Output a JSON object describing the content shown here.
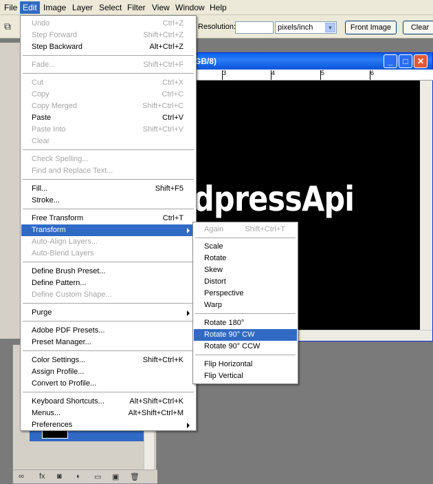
{
  "menubar": {
    "items": [
      "File",
      "Edit",
      "Image",
      "Layer",
      "Select",
      "Filter",
      "View",
      "Window",
      "Help"
    ],
    "active": "Edit"
  },
  "options_bar": {
    "resolution_label": "Resolution:",
    "resolution_value": "",
    "unit": "pixels/inch",
    "front_image_button": "Front Image",
    "clear_button": "Clear"
  },
  "document": {
    "title": "GB/8)",
    "canvas_text": "dpressApi",
    "ruler_numbers": [
      "3",
      "4",
      "5",
      "6"
    ]
  },
  "edit_menu": {
    "items": [
      {
        "label": "Undo",
        "shortcut": "Ctrl+Z",
        "disabled": true
      },
      {
        "label": "Step Forward",
        "shortcut": "Shift+Ctrl+Z",
        "disabled": true
      },
      {
        "label": "Step Backward",
        "shortcut": "Alt+Ctrl+Z",
        "disabled": false
      },
      {
        "label": "Fade...",
        "shortcut": "Shift+Ctrl+F",
        "disabled": true
      },
      {
        "label": "Cut",
        "shortcut": "Ctrl+X",
        "disabled": true
      },
      {
        "label": "Copy",
        "shortcut": "Ctrl+C",
        "disabled": true
      },
      {
        "label": "Copy Merged",
        "shortcut": "Shift+Ctrl+C",
        "disabled": true
      },
      {
        "label": "Paste",
        "shortcut": "Ctrl+V",
        "disabled": false
      },
      {
        "label": "Paste Into",
        "shortcut": "Shift+Ctrl+V",
        "disabled": true
      },
      {
        "label": "Clear",
        "shortcut": "",
        "disabled": true
      },
      {
        "label": "Check Spelling...",
        "shortcut": "",
        "disabled": true
      },
      {
        "label": "Find and Replace Text...",
        "shortcut": "",
        "disabled": true
      },
      {
        "label": "Fill...",
        "shortcut": "Shift+F5",
        "disabled": false
      },
      {
        "label": "Stroke...",
        "shortcut": "",
        "disabled": false
      },
      {
        "label": "Free Transform",
        "shortcut": "Ctrl+T",
        "disabled": false
      },
      {
        "label": "Transform",
        "shortcut": "",
        "disabled": false
      },
      {
        "label": "Auto-Align Layers...",
        "shortcut": "",
        "disabled": true
      },
      {
        "label": "Auto-Blend Layers",
        "shortcut": "",
        "disabled": true
      },
      {
        "label": "Define Brush Preset...",
        "shortcut": "",
        "disabled": false
      },
      {
        "label": "Define Pattern...",
        "shortcut": "",
        "disabled": false
      },
      {
        "label": "Define Custom Shape...",
        "shortcut": "",
        "disabled": true
      },
      {
        "label": "Purge",
        "shortcut": "",
        "disabled": false
      },
      {
        "label": "Adobe PDF Presets...",
        "shortcut": "",
        "disabled": false
      },
      {
        "label": "Preset Manager...",
        "shortcut": "",
        "disabled": false
      },
      {
        "label": "Color Settings...",
        "shortcut": "Shift+Ctrl+K",
        "disabled": false
      },
      {
        "label": "Assign Profile...",
        "shortcut": "",
        "disabled": false
      },
      {
        "label": "Convert to Profile...",
        "shortcut": "",
        "disabled": false
      },
      {
        "label": "Keyboard Shortcuts...",
        "shortcut": "Alt+Shift+Ctrl+K",
        "disabled": false
      },
      {
        "label": "Menus...",
        "shortcut": "Alt+Shift+Ctrl+M",
        "disabled": false
      },
      {
        "label": "Preferences",
        "shortcut": "",
        "disabled": false
      }
    ]
  },
  "transform_menu": {
    "items": [
      {
        "label": "Again",
        "shortcut": "Shift+Ctrl+T",
        "disabled": true
      },
      {
        "label": "Scale",
        "shortcut": "",
        "disabled": false
      },
      {
        "label": "Rotate",
        "shortcut": "",
        "disabled": false
      },
      {
        "label": "Skew",
        "shortcut": "",
        "disabled": false
      },
      {
        "label": "Distort",
        "shortcut": "",
        "disabled": false
      },
      {
        "label": "Perspective",
        "shortcut": "",
        "disabled": false
      },
      {
        "label": "Warp",
        "shortcut": "",
        "disabled": false
      },
      {
        "label": "Rotate 180°",
        "shortcut": "",
        "disabled": false
      },
      {
        "label": "Rotate 90° CW",
        "shortcut": "",
        "disabled": false
      },
      {
        "label": "Rotate 90° CCW",
        "shortcut": "",
        "disabled": false
      },
      {
        "label": "Flip Horizontal",
        "shortcut": "",
        "disabled": false
      },
      {
        "label": "Flip Vertical",
        "shortcut": "",
        "disabled": false
      }
    ]
  },
  "colors": {
    "highlight": "#316ac5",
    "menubar_bg": "#ece9d8",
    "workspace": "#7a7a7a"
  }
}
